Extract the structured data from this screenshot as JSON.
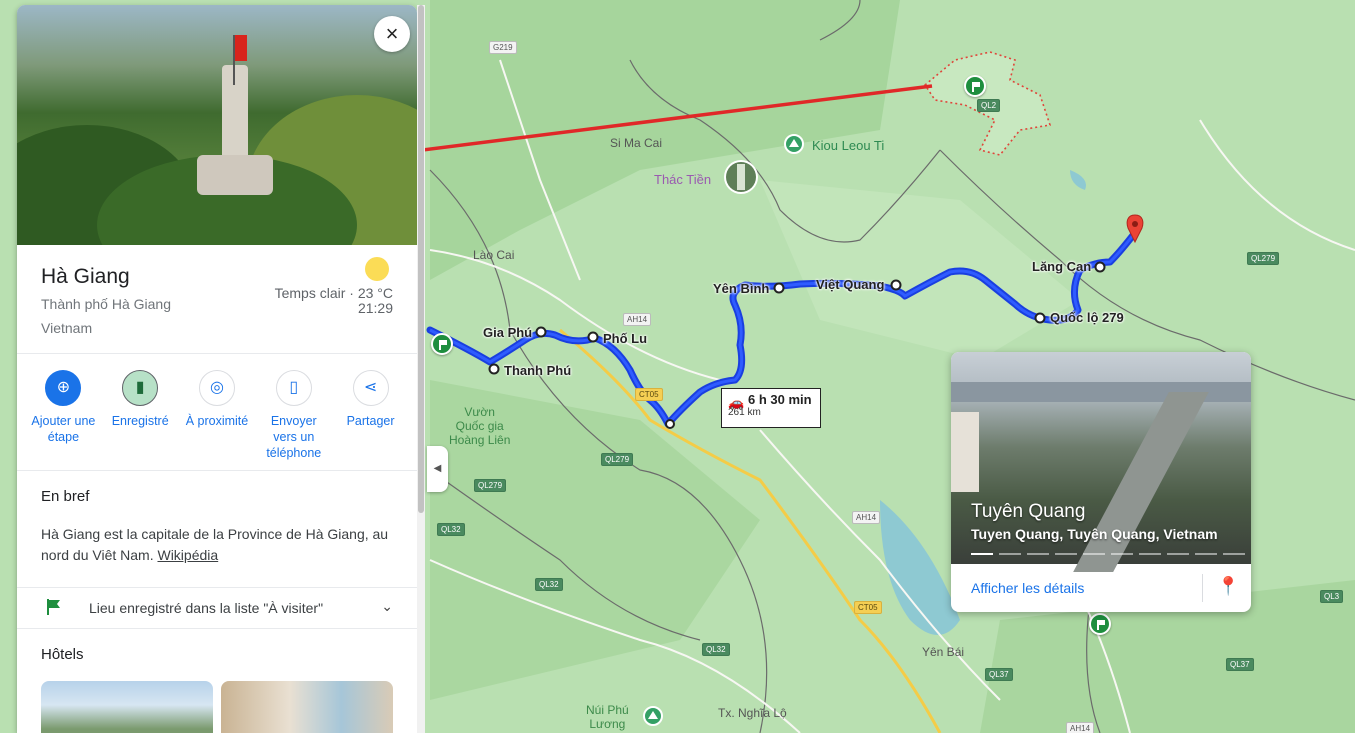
{
  "panel": {
    "title": "Hà Giang",
    "subtitle": "Thành phố Hà Giang",
    "country": "Vietnam",
    "weather_condition": "Temps clair · 23 °C",
    "weather_time": "21:29",
    "close_icon": "×",
    "actions": [
      {
        "label": "Ajouter une étape",
        "icon": "add-stop-icon"
      },
      {
        "label": "Enregistré",
        "icon": "bookmark-icon"
      },
      {
        "label": "À proximité",
        "icon": "nearby-icon"
      },
      {
        "label": "Envoyer vers un téléphone",
        "icon": "send-to-phone-icon"
      },
      {
        "label": "Partager",
        "icon": "share-icon"
      }
    ],
    "overview_heading": "En bref",
    "overview_text": "Hà Giang est la capitale de la Province de Hà Giang, au nord du Viêt Nam.",
    "overview_link": "Wikipédia",
    "saved_list": "Lieu enregistré dans la liste \"À visiter\"",
    "hotels_heading": "Hôtels"
  },
  "map": {
    "labels": {
      "si_ma_cai": "Si Ma Cai",
      "kiou_leou_ti": "Kiou Leou Ti",
      "thac_tien": "Thác Tiền",
      "lao_cai": "Lào Cai",
      "lang_can": "Lăng Can",
      "yen_binh": "Yên Bình",
      "viet_quang": "Việt Quang",
      "quoc_lo_279": "Quốc lộ 279",
      "gia_phu": "Gia Phú",
      "pho_lu": "Phố Lu",
      "thanh_phu": "Thanh Phú",
      "vuon_quoc_gia": "Vườn\nQuốc gia\nHoàng Liên",
      "yen_bai": "Yên Bái",
      "nui_phu_luong": "Núi Phú\nLương",
      "tx_nghia_lo": "Tx. Nghĩa Lộ"
    },
    "shields": {
      "g219": "G219",
      "ql2": "QL2",
      "ql279_a": "QL279",
      "ah14_a": "AH14",
      "ct05_a": "CT05",
      "ql279_b": "QL279",
      "ql279_c": "QL279",
      "ql32_a": "QL32",
      "ql32_b": "QL32",
      "ah14_b": "AH14",
      "ct05_b": "CT05",
      "ql32_c": "QL32",
      "ql37_a": "QL37",
      "ql37_b": "QL37",
      "ql3": "QL3",
      "ah14_c": "AH14"
    },
    "route_duration": "6 h 30 min",
    "route_distance": "261 km",
    "colors": {
      "route": "#1a3fe0",
      "line": "#e02828",
      "saved_flag": "#1e8e3e",
      "destination_pin": "#ea4335"
    }
  },
  "card": {
    "title": "Tuyên Quang",
    "subtitle": "Tuyen Quang, Tuyên Quang, Vietnam",
    "details_link": "Afficher les détails",
    "add_icon": "add-location-icon"
  }
}
